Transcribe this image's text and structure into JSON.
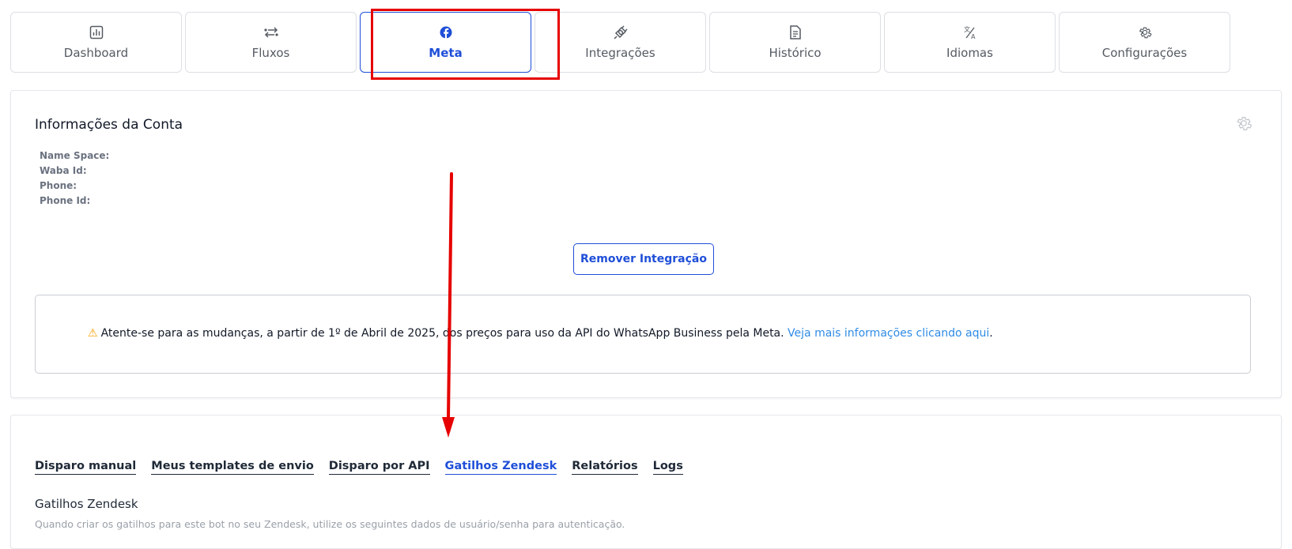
{
  "nav": {
    "items": [
      {
        "label": "Dashboard",
        "icon": "chart-bar-icon",
        "active": false
      },
      {
        "label": "Fluxos",
        "icon": "flow-arrows-icon",
        "active": false
      },
      {
        "label": "Meta",
        "icon": "facebook-icon",
        "active": true
      },
      {
        "label": "Integrações",
        "icon": "plug-icon",
        "active": false
      },
      {
        "label": "Histórico",
        "icon": "document-icon",
        "active": false
      },
      {
        "label": "Idiomas",
        "icon": "translate-icon",
        "active": false
      },
      {
        "label": "Configurações",
        "icon": "gear-icon",
        "active": false
      }
    ]
  },
  "account": {
    "title": "Informações da Conta",
    "fields": [
      "Name Space:",
      "Waba Id:",
      "Phone:",
      "Phone Id:"
    ],
    "remove_button": "Remover Integração"
  },
  "notice": {
    "text": "Atente-se para as mudanças, a partir de 1º de Abril de 2025, dos preços para uso da API do WhatsApp Business pela Meta. ",
    "link": "Veja mais informações clicando aqui",
    "suffix": "."
  },
  "tabs": {
    "items": [
      "Disparo manual",
      "Meus templates de envio",
      "Disparo por API",
      "Gatilhos Zendesk",
      "Relatórios",
      "Logs"
    ],
    "active_index": 3
  },
  "section": {
    "title": "Gatilhos Zendesk",
    "description": "Quando criar os gatilhos para este bot no seu Zendesk, utilize os seguintes dados de usuário/senha para autenticação."
  },
  "colors": {
    "accent": "#1f4fd8",
    "annotation": "#e60000",
    "link": "#2f8be6",
    "warning": "#f5a100"
  }
}
